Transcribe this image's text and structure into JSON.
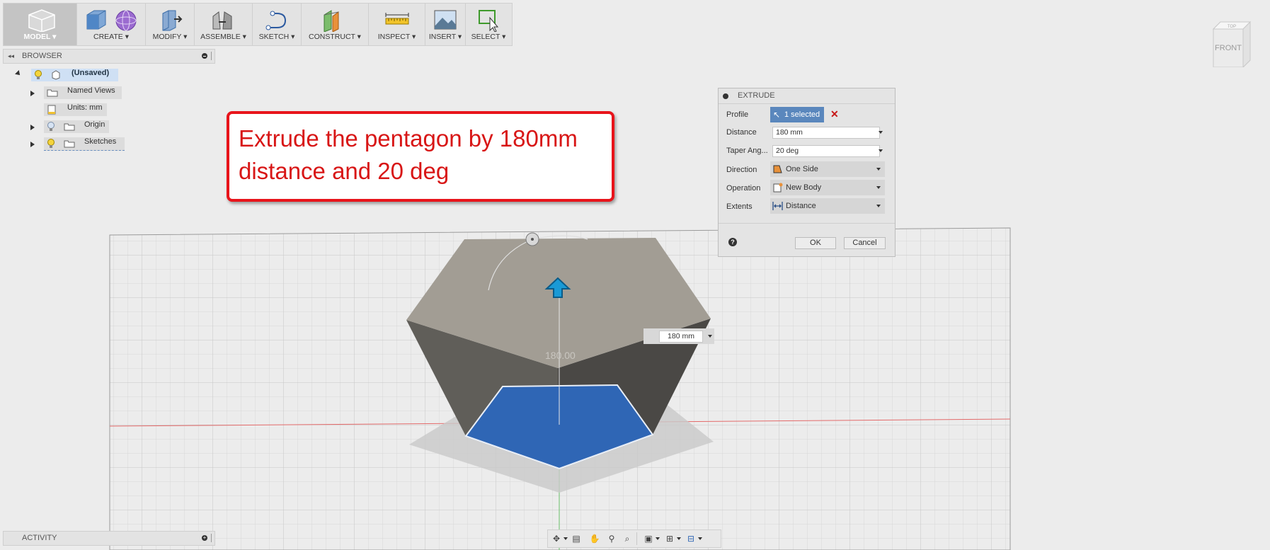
{
  "toolbar": {
    "groups": [
      {
        "label": "MODEL ▾",
        "icon": "model-workspace-icon"
      },
      {
        "label": "CREATE ▾",
        "icon": "create-box-icon"
      },
      {
        "label": "MODIFY ▾",
        "icon": "modify-icon"
      },
      {
        "label": "ASSEMBLE ▾",
        "icon": "assemble-icon"
      },
      {
        "label": "SKETCH ▾",
        "icon": "sketch-icon"
      },
      {
        "label": "CONSTRUCT ▾",
        "icon": "construct-plane-icon"
      },
      {
        "label": "INSPECT ▾",
        "icon": "measure-ruler-icon"
      },
      {
        "label": "INSERT ▾",
        "icon": "insert-image-icon"
      },
      {
        "label": "SELECT ▾",
        "icon": "select-arrow-icon"
      }
    ]
  },
  "browser": {
    "title": "BROWSER",
    "items": [
      {
        "label": "(Unsaved)"
      },
      {
        "label": "Named Views"
      },
      {
        "label": "Units: mm"
      },
      {
        "label": "Origin"
      },
      {
        "label": "Sketches"
      }
    ]
  },
  "activity": {
    "title": "ACTIVITY"
  },
  "callout": {
    "text": "Extrude the pentagon by 180mm distance and 20 deg"
  },
  "extrude": {
    "title": "EXTRUDE",
    "profile_label": "Profile",
    "profile_value": "1 selected",
    "distance_label": "Distance",
    "distance_value": "180 mm",
    "taper_label": "Taper Ang...",
    "taper_value": "20 deg",
    "direction_label": "Direction",
    "direction_value": "One Side",
    "operation_label": "Operation",
    "operation_value": "New Body",
    "extents_label": "Extents",
    "extents_value": "Distance",
    "ok_label": "OK",
    "cancel_label": "Cancel"
  },
  "viewport": {
    "dimension_field": "180 mm",
    "dimension_text": "180.00"
  },
  "viewcube": {
    "top": "TOP",
    "front": "FRONT"
  },
  "colors": {
    "accent": "#2f66b5",
    "callout_red": "#e8141b",
    "selected": "#5a87bd"
  }
}
